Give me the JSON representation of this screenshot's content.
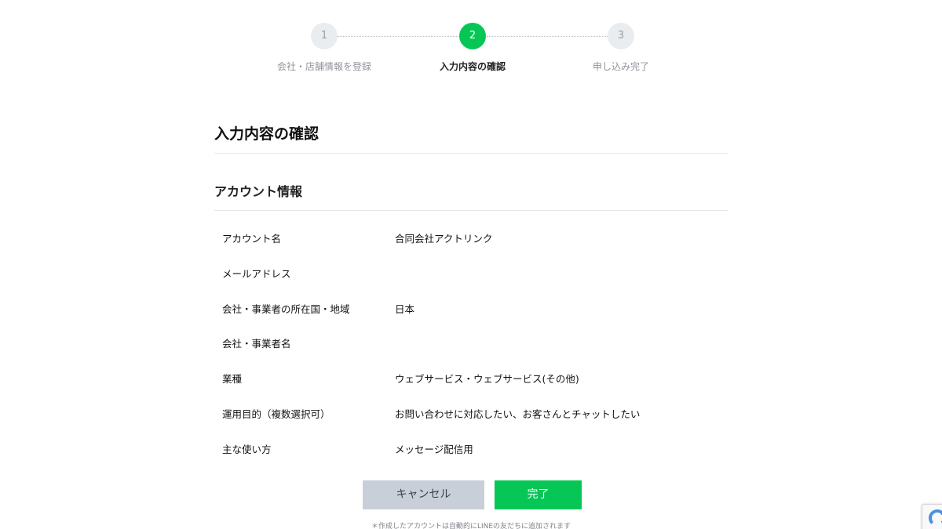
{
  "stepper": {
    "steps": [
      {
        "number": "1",
        "label": "会社・店舗情報を登録",
        "state": "done"
      },
      {
        "number": "2",
        "label": "入力内容の確認",
        "state": "active"
      },
      {
        "number": "3",
        "label": "申し込み完了",
        "state": "pending"
      }
    ]
  },
  "page": {
    "title": "入力内容の確認",
    "section_title": "アカウント情報"
  },
  "account_info": {
    "rows": [
      {
        "label": "アカウント名",
        "value": "合同会社アクトリンク"
      },
      {
        "label": "メールアドレス",
        "value": ""
      },
      {
        "label": "会社・事業者の所在国・地域",
        "value": "日本"
      },
      {
        "label": "会社・事業者名",
        "value": ""
      },
      {
        "label": "業種",
        "value": "ウェブサービス・ウェブサービス(その他)"
      },
      {
        "label": "運用目的（複数選択可）",
        "value": "お問い合わせに対応したい、お客さんとチャットしたい"
      },
      {
        "label": "主な使い方",
        "value": "メッセージ配信用"
      }
    ]
  },
  "actions": {
    "cancel_label": "キャンセル",
    "done_label": "完了",
    "footnote": "＊作成したアカウントは自動的にLINEの友だちに追加されます"
  },
  "colors": {
    "accent": "#06c755",
    "cancel_bg": "#c9cfd8",
    "divider": "#e4e6e9"
  },
  "icons": {
    "recaptcha": "recaptcha-icon"
  }
}
